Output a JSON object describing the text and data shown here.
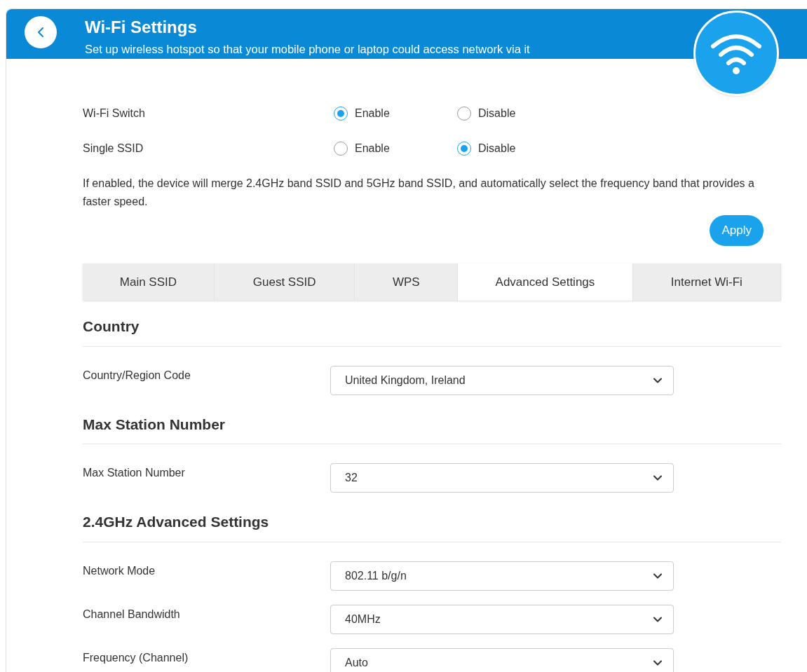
{
  "header": {
    "title": "Wi-Fi Settings",
    "subtitle": "Set up wireless hotspot so that your mobile phone or laptop could access network via it"
  },
  "radio_rows": [
    {
      "label": "Wi-Fi Switch",
      "options": [
        {
          "label": "Enable",
          "selected": true
        },
        {
          "label": "Disable",
          "selected": false
        }
      ]
    },
    {
      "label": "Single SSID",
      "options": [
        {
          "label": "Enable",
          "selected": false
        },
        {
          "label": "Disable",
          "selected": true
        }
      ]
    }
  ],
  "note": "If enabled, the device will merge 2.4GHz band SSID and 5GHz band SSID, and automatically select the frequency band that provides a faster speed.",
  "apply_button": "Apply",
  "tabs": [
    {
      "label": "Main SSID",
      "selected": false
    },
    {
      "label": "Guest SSID",
      "selected": false
    },
    {
      "label": "WPS",
      "selected": false
    },
    {
      "label": "Advanced Settings",
      "selected": true
    },
    {
      "label": "Internet Wi-Fi",
      "selected": false
    }
  ],
  "sections": [
    {
      "title": "Country",
      "fields": [
        {
          "label": "Country/Region Code",
          "value": "United Kingdom, Ireland"
        }
      ]
    },
    {
      "title": "Max Station Number",
      "fields": [
        {
          "label": "Max Station Number",
          "value": "32"
        }
      ]
    },
    {
      "title": "2.4GHz Advanced Settings",
      "fields": [
        {
          "label": "Network Mode",
          "value": "802.11 b/g/n"
        },
        {
          "label": "Channel Bandwidth",
          "value": "40MHz"
        },
        {
          "label": "Frequency (Channel)",
          "value": "Auto"
        }
      ]
    }
  ]
}
